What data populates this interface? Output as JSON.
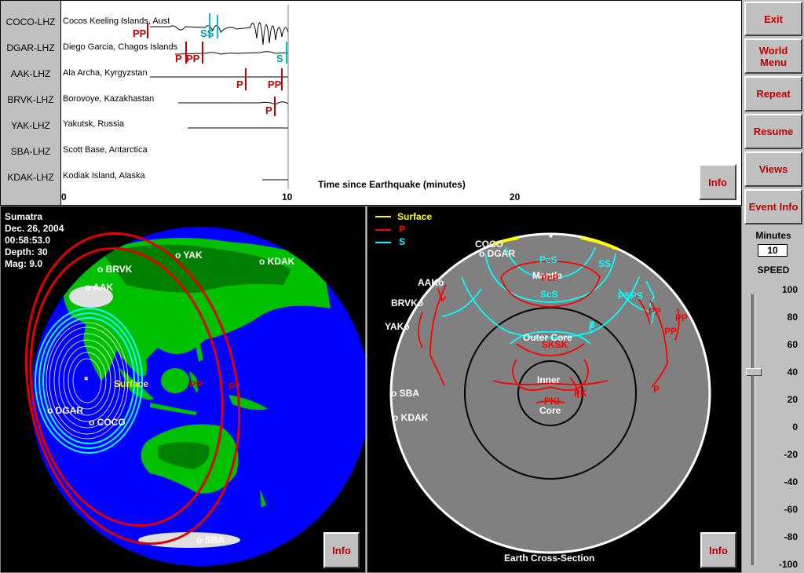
{
  "seismograms": {
    "stations": [
      {
        "code": "COCO-LHZ",
        "name": "Cocos Keeling Islands, Aust"
      },
      {
        "code": "DGAR-LHZ",
        "name": "Diego Garcia, Chagos Islands"
      },
      {
        "code": "AAK-LHZ",
        "name": "Ala Archa, Kyrgyzstan"
      },
      {
        "code": "BRVK-LHZ",
        "name": "Borovoye, Kazakhastan"
      },
      {
        "code": "YAK-LHZ",
        "name": "Yakutsk, Russia"
      },
      {
        "code": "SBA-LHZ",
        "name": "Scott Base, Antarctica"
      },
      {
        "code": "KDAK-LHZ",
        "name": "Kodiak Island, Alaska"
      }
    ],
    "axis_title": "Time since Earthquake (minutes)",
    "ticks": [
      "0",
      "10",
      "20"
    ],
    "info_label": "Info",
    "phase_labels": {
      "p": "P",
      "pp": "PP",
      "s": "S",
      "ss": "SS"
    }
  },
  "event": {
    "region": "Sumatra",
    "date": "Dec. 26, 2004",
    "time": "00:58:53.0",
    "depth": "Depth:   30",
    "mag": "Mag:  9.0"
  },
  "globe": {
    "stations": [
      "o YAK",
      "o KDAK",
      "o BRVK",
      "o AAK",
      "o DGAR",
      "o COCO",
      "o SBA"
    ],
    "surface_label": "Surface",
    "pp_label": "PP",
    "p_label": "P",
    "epicenter": "*",
    "info_label": "Info"
  },
  "cross_section": {
    "legend": [
      {
        "label": "Surface",
        "color": "#ffff00"
      },
      {
        "label": "P",
        "color": "#ff0000"
      },
      {
        "label": "S",
        "color": "#00ffff"
      }
    ],
    "stations": [
      "COCO",
      "o DGAR",
      "AAKo",
      "BRVKo",
      "YAKo",
      "o SBA",
      "o KDAK"
    ],
    "phases": {
      "pcs": "PcS",
      "mantle": "Mantle",
      "pcp": "PcP",
      "ss": "SS",
      "scs": "ScS",
      "psps": "PSPS",
      "s": "S",
      "pp": "PP",
      "pp2": "PP",
      "p": "P",
      "ptop": "PP",
      "outer": "Outer Core",
      "sksk": "SKSK",
      "inner": "Inner",
      "pki": "PKI",
      "pk": "PK",
      "core": "Core",
      "p2": "P"
    },
    "epicenter": "*",
    "title": "Earth Cross-Section",
    "info_label": "Info"
  },
  "controls": {
    "buttons": [
      "Exit",
      "World Menu",
      "Repeat",
      "Resume",
      "Views",
      "Event Info"
    ],
    "minutes_label": "Minutes",
    "minutes_value": "10",
    "speed_label": "SPEED",
    "speed_ticks": [
      "100",
      "80",
      "60",
      "40",
      "20",
      "0",
      "-20",
      "-40",
      "-60",
      "-80",
      "-100"
    ],
    "speed_value": 40
  },
  "colors": {
    "p": "#c00000",
    "s": "#00c0c0",
    "surface": "#ffff00",
    "ocean": "#0000ff",
    "land": "#00c000",
    "mantle": "#808080"
  }
}
